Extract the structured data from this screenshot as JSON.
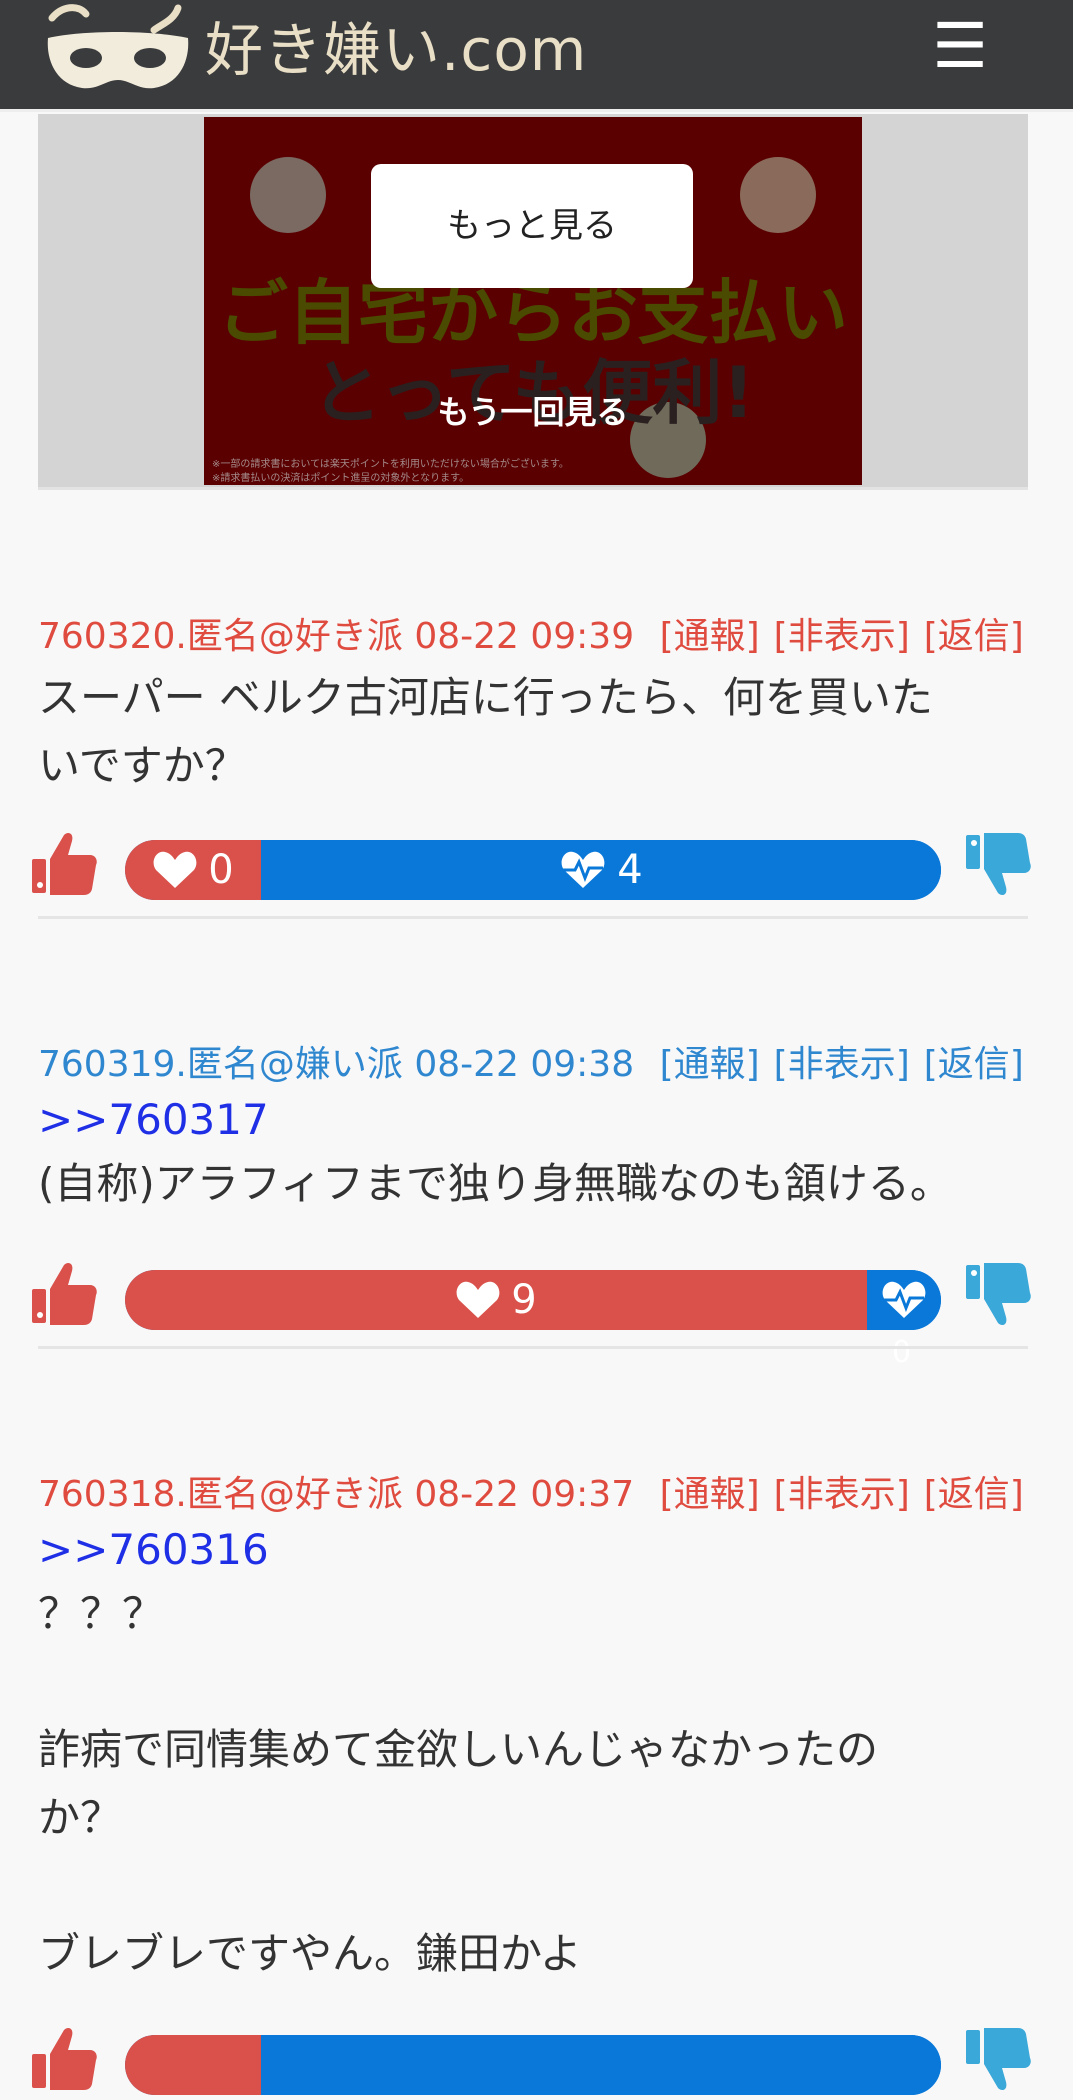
{
  "header": {
    "site_title": "好き嫌い.com",
    "menu_icon": "☰"
  },
  "ad": {
    "more_label": "もっと見る",
    "replay_label": "もう一回見る",
    "headline1": "ご自宅からお支払い",
    "headline2": "とっても便利!",
    "fine1": "※一部の請求書においては楽天ポイントを利用いただけない場合がございます。",
    "fine2": "※請求書払いの決済はポイント進呈の対象外となります。"
  },
  "comments": [
    {
      "meta": "760320.匿名@好き派 08-22 09:39",
      "report": "[通報]",
      "hide": "[非表示]",
      "reply": "[返信]",
      "stance": "like",
      "anchor": "",
      "lines": [
        "スーパー ベルク古河店に行ったら、何を買いた",
        "いですか？"
      ],
      "likes": "0",
      "dislikes": "4"
    },
    {
      "meta": "760319.匿名@嫌い派 08-22 09:38",
      "report": "[通報]",
      "hide": "[非表示]",
      "reply": "[返信]",
      "stance": "dislike",
      "anchor": ">>760317",
      "lines": [
        "(自称)アラフィフまで独り身無職なのも頷ける。"
      ],
      "likes": "9",
      "dislikes": "0"
    },
    {
      "meta": "760318.匿名@好き派 08-22 09:37",
      "report": "[通報]",
      "hide": "[非表示]",
      "reply": "[返信]",
      "stance": "like",
      "anchor": ">>760316",
      "lines": [
        "？？？",
        "",
        "詐病で同情集めて金欲しいんじゃなかったの",
        "か？",
        "",
        "ブレブレですやん。鎌田かよ"
      ],
      "likes": "",
      "dislikes": ""
    }
  ],
  "colors": {
    "header_bg": "#3a3b3d",
    "like_red": "#d9514a",
    "dislike_blue": "#0a78d8",
    "thumb_up": "#d9514a",
    "thumb_down": "#3aa8d8"
  },
  "icons": {
    "thumb_up": "thumbs-up-icon",
    "thumb_down": "thumbs-down-icon",
    "heart": "heart-icon",
    "heartbeat": "heart-pulse-icon",
    "menu": "hamburger-menu-icon",
    "logo": "mask-logo-icon"
  }
}
